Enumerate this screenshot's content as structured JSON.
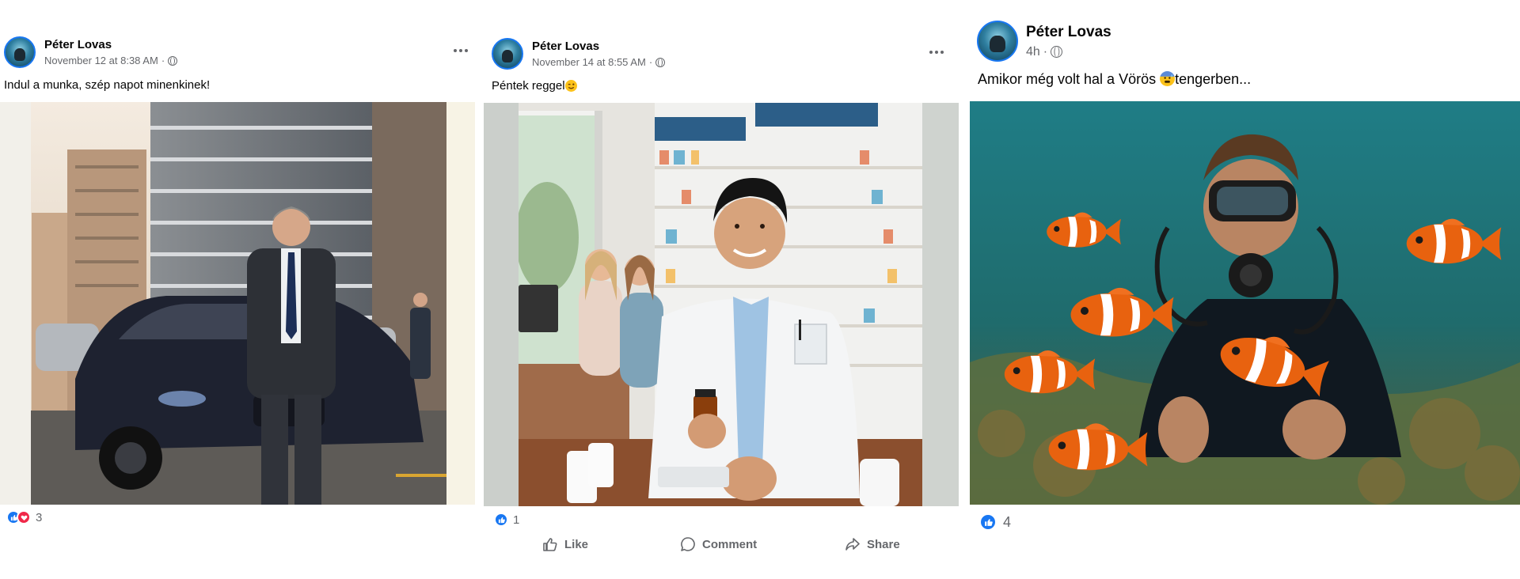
{
  "posts": [
    {
      "author": "Péter Lovas",
      "timestamp": "November 12 at 8:38 AM",
      "caption": "Indul a munka, szép napot minenkinek!",
      "reactions": {
        "types": [
          "like-icon",
          "love-icon"
        ],
        "count": "3"
      },
      "has_more_menu": true
    },
    {
      "author": "Péter Lovas",
      "timestamp": "November 14 at 8:55 AM",
      "caption": "Péntek reggel",
      "caption_emoji": "winking-face-emoji",
      "reactions": {
        "types": [
          "like-icon"
        ],
        "count": "1"
      },
      "actions": {
        "like": "Like",
        "comment": "Comment",
        "share": "Share"
      },
      "has_more_menu": true
    },
    {
      "author": "Péter Lovas",
      "timestamp": "4h",
      "caption_before": "Amikor még volt hal a Vörös ",
      "caption_emoji": "anxious-face-with-sweat-emoji",
      "caption_after": "tengerben...",
      "reactions": {
        "types": [
          "like-icon"
        ],
        "count": "4"
      }
    }
  ],
  "colors": {
    "brand": "#1877f2",
    "love": "#f02849",
    "meta_text": "#65676b"
  }
}
